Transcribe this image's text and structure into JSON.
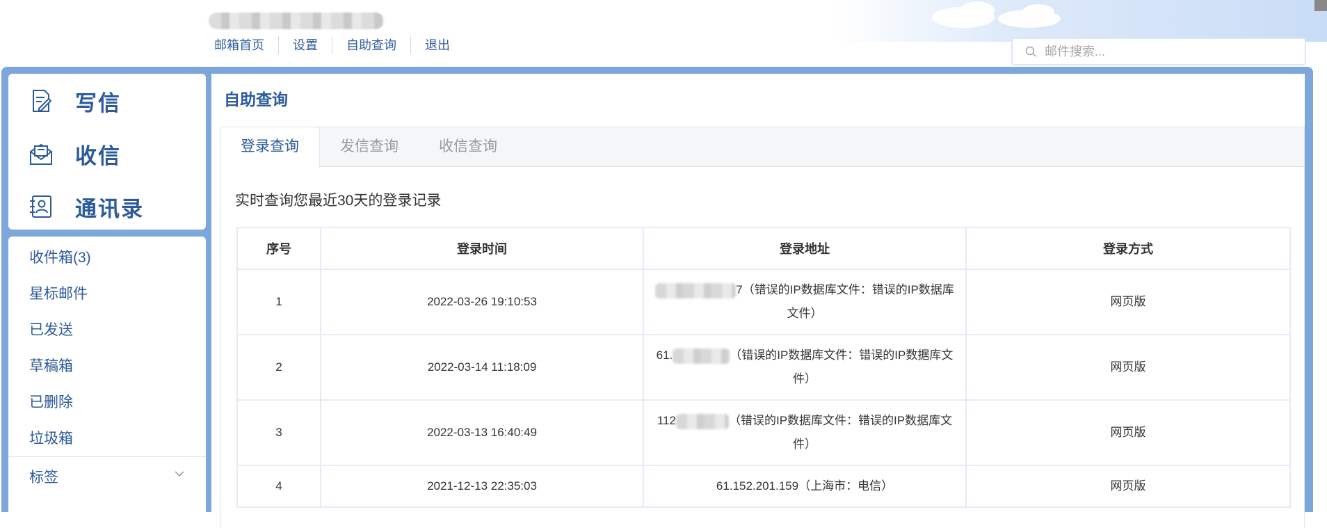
{
  "header": {
    "nav": [
      "邮箱首页",
      "设置",
      "自助查询",
      "退出"
    ],
    "search_placeholder": "邮件搜索..."
  },
  "sidebar": {
    "main_actions": [
      {
        "label": "写信",
        "icon": "compose-icon"
      },
      {
        "label": "收信",
        "icon": "inbox-icon"
      },
      {
        "label": "通讯录",
        "icon": "contacts-icon"
      }
    ],
    "folders": [
      "收件箱(3)",
      "星标邮件",
      "已发送",
      "草稿箱",
      "已删除",
      "垃圾箱"
    ],
    "tags_label": "标签"
  },
  "main": {
    "title": "自助查询",
    "tabs": [
      "登录查询",
      "发信查询",
      "收信查询"
    ],
    "active_tab": "登录查询",
    "description": "实时查询您最近30天的登录记录",
    "table": {
      "headers": [
        "序号",
        "登录时间",
        "登录地址",
        "登录方式"
      ],
      "rows": [
        {
          "index": "1",
          "time": "2022-03-26 19:10:53",
          "ip_visible": "7",
          "location": "（错误的IP数据库文件：错误的IP数据库文件）",
          "method": "网页版"
        },
        {
          "index": "2",
          "time": "2022-03-14 11:18:09",
          "ip_visible": "61.",
          "location": "（错误的IP数据库文件：错误的IP数据库文件）",
          "method": "网页版"
        },
        {
          "index": "3",
          "time": "2022-03-13 16:40:49",
          "ip_visible": "112",
          "location": "（错误的IP数据库文件：错误的IP数据库文件）",
          "method": "网页版"
        },
        {
          "index": "4",
          "time": "2021-12-13 22:35:03",
          "ip_visible": "61.152.201.159",
          "location": "（上海市：电信）",
          "method": "网页版"
        }
      ]
    }
  },
  "colors": {
    "accent": "#2c5a9b",
    "frame": "#7ca6dc",
    "nav_link": "#2f5e9e"
  }
}
